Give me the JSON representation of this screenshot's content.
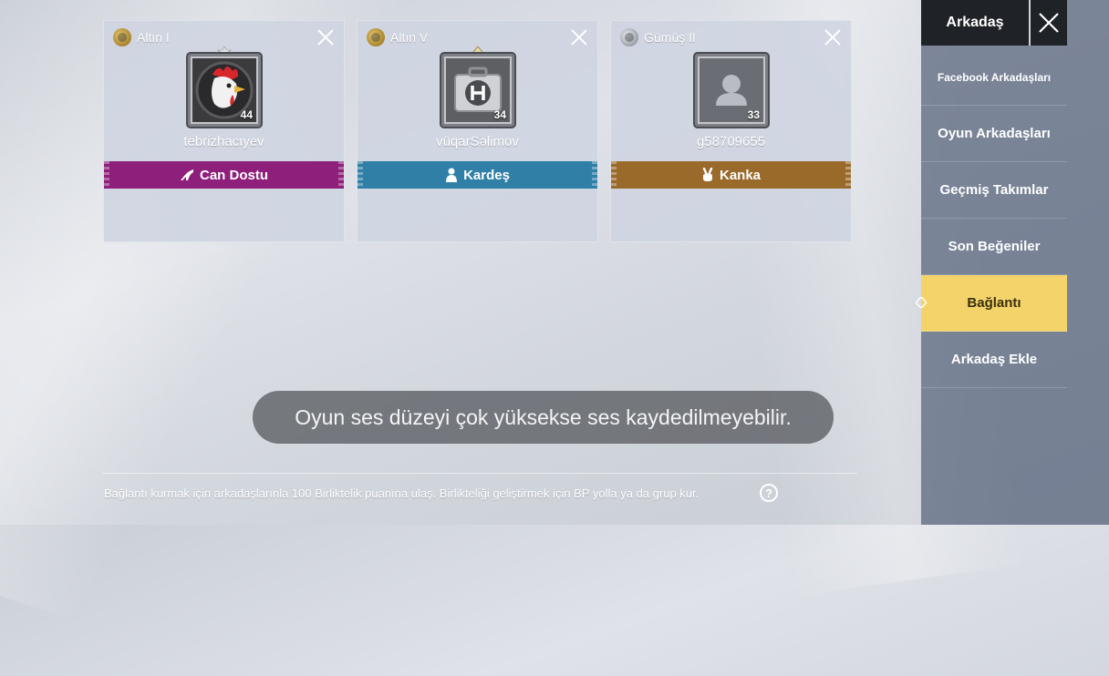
{
  "friends": [
    {
      "rank": "Altın I",
      "level": "44",
      "username": "tebrizhacıyev",
      "relation": "Can Dostu",
      "relation_icon": "heel-icon",
      "relation_color": "#8e1f7a",
      "avatar": "rooster-avatar"
    },
    {
      "rank": "Altın V",
      "level": "34",
      "username": "vüqarSəlimov",
      "relation": "Kardeş",
      "relation_icon": "person-icon",
      "relation_color": "#2f7fa6",
      "avatar": "helipad-case-avatar"
    },
    {
      "rank": "Gümüş II",
      "level": "33",
      "username": "g58709655",
      "relation": "Kanka",
      "relation_icon": "peace-hand-icon",
      "relation_color": "#9a6a2b",
      "avatar": "default-avatar"
    }
  ],
  "sidebar": {
    "title": "Arkadaş",
    "items": [
      {
        "label": "Facebook Arkadaşları",
        "active": false
      },
      {
        "label": "Oyun Arkadaşları",
        "active": false
      },
      {
        "label": "Geçmiş Takımlar",
        "active": false
      },
      {
        "label": "Son Beğeniler",
        "active": false
      },
      {
        "label": "Bağlantı",
        "active": true
      },
      {
        "label": "Arkadaş Ekle",
        "active": false
      }
    ],
    "active_color": "#f3d36a"
  },
  "toast": {
    "message": "Oyun ses düzeyi çok yüksekse ses kaydedilmeyebilir."
  },
  "hint": {
    "text": "Bağlantı kurmak için arkadaşlarınla 100 Birliktelik puanına ulaş. Birlikteliği geliştirmek için BP yolla ya da grup kur.",
    "help_symbol": "?"
  }
}
